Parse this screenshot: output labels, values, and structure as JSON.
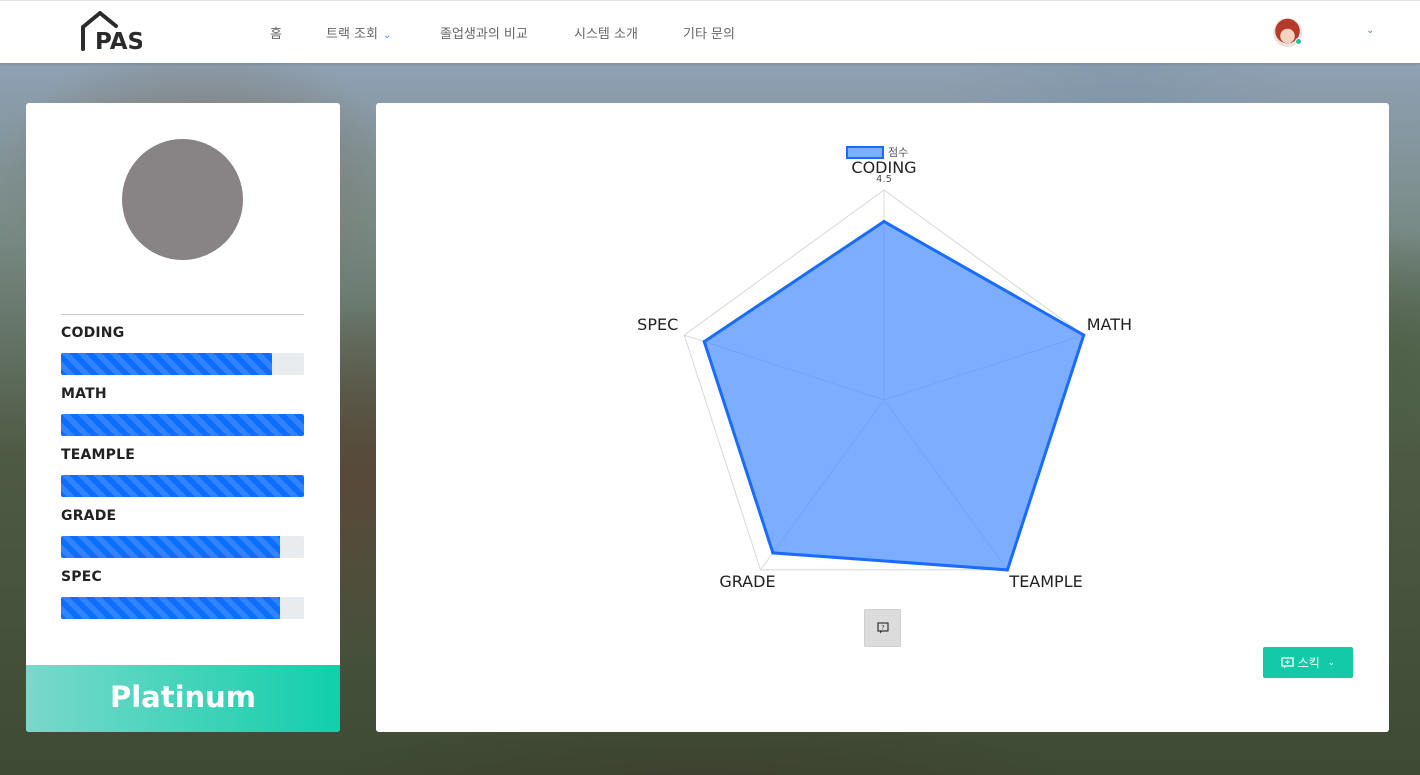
{
  "nav": {
    "items": [
      {
        "label": "홈"
      },
      {
        "label": "트랙 조회",
        "has_dropdown": true
      },
      {
        "label": "졸업생과의 비교"
      },
      {
        "label": "시스템 소개"
      },
      {
        "label": "기타 문의"
      }
    ],
    "logo_text": "PAS"
  },
  "profile": {
    "stats": [
      {
        "label": "CODING",
        "value": 0.87
      },
      {
        "label": "MATH",
        "value": 1.0
      },
      {
        "label": "TEAMPLE",
        "value": 1.0
      },
      {
        "label": "GRADE",
        "value": 0.9
      },
      {
        "label": "SPEC",
        "value": 0.9
      }
    ],
    "tier": "Platinum"
  },
  "chart_data": {
    "type": "radar",
    "labels": [
      "CODING",
      "MATH",
      "TEAMPLE",
      "GRADE",
      "SPEC"
    ],
    "series": [
      {
        "name": "점수",
        "values": [
          4.25,
          5.0,
          5.0,
          4.5,
          4.5
        ]
      }
    ],
    "r_max": 5,
    "tick_labels": [
      "4.5"
    ],
    "legend": "top"
  },
  "buttons": {
    "skill_label": "스킥"
  },
  "colors": {
    "accent": "#0d6efd",
    "teal": "#14c9a7",
    "radar_fill": "#7aacff",
    "radar_stroke": "#1a6bff"
  }
}
